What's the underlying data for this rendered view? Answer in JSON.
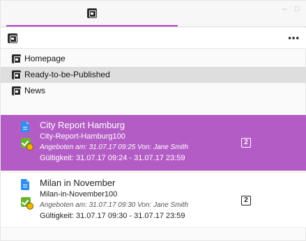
{
  "header": {
    "minimize_label": "–",
    "maximize_label": "□"
  },
  "toolbar": {
    "more_label": "•••"
  },
  "folders": [
    {
      "label": "Homepage",
      "selected": false
    },
    {
      "label": "Ready-to-be-Published",
      "selected": true
    },
    {
      "label": "News",
      "selected": false
    }
  ],
  "cards": [
    {
      "title": "City Report Hamburg",
      "id_line": "City-Report-Hamburg100",
      "offered": "Angeboten am: 31.07.17 09:25 Von: Jane Smith",
      "validity": "Gültigkeit: 31.07.17 09:24 - 31.07.17 23:59",
      "count": "2",
      "active": true
    },
    {
      "title": "Milan in November",
      "id_line": "Milan-in-November100",
      "offered": "Angeboten am: 31.07.17 09:30 Von: Jane Smith",
      "validity": "Gültigkeit: 31.07.17 09:30 - 31.07.17 23:59",
      "count": "2",
      "active": false
    }
  ],
  "colors": {
    "accent": "#b23ad1",
    "active_card": "#b45cc6",
    "doc_icon": "#2f8ff0",
    "status_green": "#6ab32e",
    "status_yellow": "#f5b400"
  },
  "icons": {
    "tab_icon": "box-icon",
    "toolbar_icon": "box-icon",
    "folder_icon": "box-icon",
    "card_doc_icon": "document-icon",
    "card_status_icon": "approved-pending-icon",
    "card_count_icon": "count-badge-icon"
  }
}
